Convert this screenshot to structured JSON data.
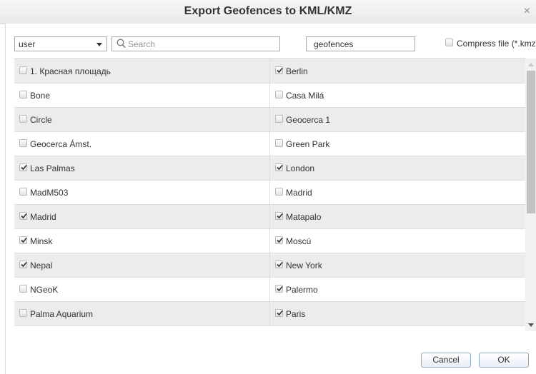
{
  "dialog": {
    "title": "Export Geofences to KML/KMZ",
    "close_glyph": "×"
  },
  "toolbar": {
    "user_select_value": "user",
    "search_placeholder": "Search",
    "filename_value": "geofences",
    "compress_label": "Compress file (*.kmz)",
    "compress_checked": false
  },
  "geofences": {
    "rows": [
      {
        "left": {
          "name": "1. Красная площадь",
          "checked": false
        },
        "right": {
          "name": "Berlin",
          "checked": true
        }
      },
      {
        "left": {
          "name": "Bone",
          "checked": false
        },
        "right": {
          "name": "Casa Milá",
          "checked": false
        }
      },
      {
        "left": {
          "name": "Circle",
          "checked": false
        },
        "right": {
          "name": "Geocerca 1",
          "checked": false
        }
      },
      {
        "left": {
          "name": "Geocerca Ámst.",
          "checked": false
        },
        "right": {
          "name": "Green Park",
          "checked": false
        }
      },
      {
        "left": {
          "name": "Las Palmas",
          "checked": true
        },
        "right": {
          "name": "London",
          "checked": true
        }
      },
      {
        "left": {
          "name": "MadM503",
          "checked": false
        },
        "right": {
          "name": "Madrid",
          "checked": false
        }
      },
      {
        "left": {
          "name": "Madrid",
          "checked": true
        },
        "right": {
          "name": "Matapalo",
          "checked": true
        }
      },
      {
        "left": {
          "name": "Minsk",
          "checked": true
        },
        "right": {
          "name": "Moscú",
          "checked": true
        }
      },
      {
        "left": {
          "name": "Nepal",
          "checked": true
        },
        "right": {
          "name": "New York",
          "checked": true
        }
      },
      {
        "left": {
          "name": "NGeoK",
          "checked": false
        },
        "right": {
          "name": "Palermo",
          "checked": true
        }
      },
      {
        "left": {
          "name": "Palma Aquarium",
          "checked": false
        },
        "right": {
          "name": "Paris",
          "checked": true
        }
      }
    ]
  },
  "footer": {
    "cancel_label": "Cancel",
    "ok_label": "OK"
  },
  "colors": {
    "row_shade": "#ececec",
    "button_border": "#8fa8c8"
  },
  "icons": {
    "search": "search-icon",
    "checkmark": "checkmark-icon",
    "close": "close-icon",
    "dropdown": "chevron-down-icon"
  }
}
